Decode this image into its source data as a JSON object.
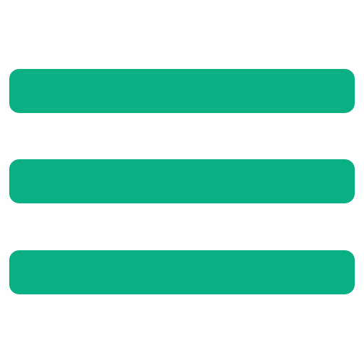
{
  "icon": {
    "name": "hamburger-menu-icon",
    "color": "#0ab084",
    "background": "#ffffff",
    "bar_count": 3
  }
}
